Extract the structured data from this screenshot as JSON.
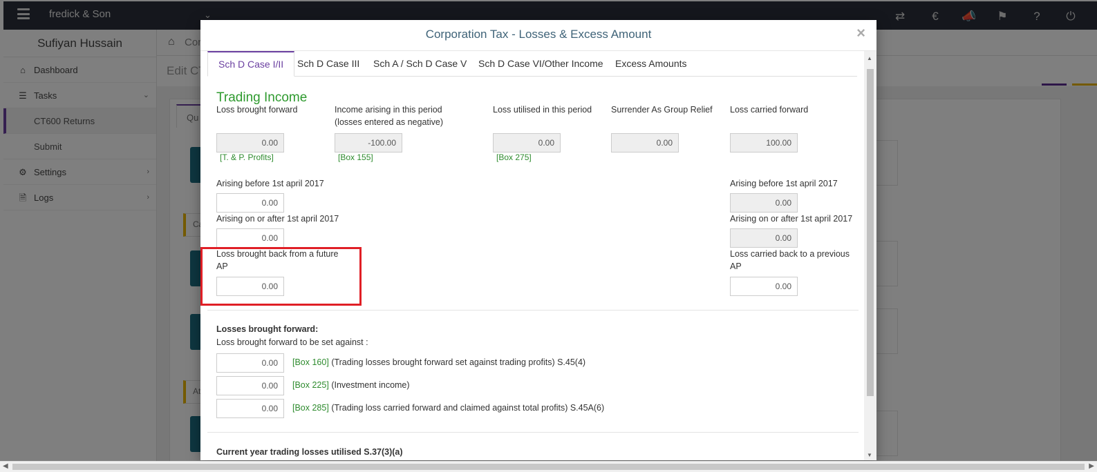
{
  "topbar": {
    "company": "fredick & Son",
    "icons": [
      "menu-icon",
      "chevron-down-icon",
      "transfer-icon",
      "currency-icon",
      "announcement-icon",
      "tag-icon",
      "help-icon",
      "power-icon"
    ]
  },
  "sidebar": {
    "user": "Sufiyan Hussain",
    "items": [
      {
        "label": "Dashboard",
        "icon": "home-icon"
      },
      {
        "label": "Tasks",
        "icon": "list-icon"
      },
      {
        "label": "Settings",
        "icon": "gear-icon"
      },
      {
        "label": "Logs",
        "icon": "file-icon"
      }
    ],
    "subitems": [
      "CT600 Returns",
      "Submit"
    ]
  },
  "background": {
    "breadcrumb": "Cor",
    "edit_title": "Edit CT",
    "tab_fragment": "Qu",
    "card_fragment_1": "Ca",
    "card_fragment_2": "At"
  },
  "modal": {
    "title": "Corporation Tax - Losses & Excess Amount",
    "close": "×",
    "tabs": [
      "Sch D Case I/II",
      "Sch D Case III",
      "Sch A / Sch D Case V",
      "Sch D Case VI/Other Income",
      "Excess Amounts"
    ],
    "active_tab": 0,
    "section_title": "Trading Income",
    "columns": {
      "loss_bf": {
        "label": "Loss brought forward",
        "value": "0.00",
        "box": "[T. & P. Profits]"
      },
      "income": {
        "label": "Income arising in this period (losses entered as negative)",
        "value": "-100.00",
        "box": "[Box 155]"
      },
      "utilised": {
        "label": "Loss utilised in this period",
        "value": "0.00",
        "box": "[Box 275]"
      },
      "surrender": {
        "label": "Surrender As Group Relief",
        "value": "0.00"
      },
      "loss_cf": {
        "label": "Loss carried forward",
        "value": "100.00"
      }
    },
    "left_extra": {
      "before_label": "Arising before 1st april 2017",
      "before_value": "0.00",
      "after_label": "Arising on or after 1st april 2017",
      "after_value": "0.00",
      "future_label": "Loss brought back from a future AP",
      "future_value": "0.00"
    },
    "right_extra": {
      "before_label": "Arising before 1st april 2017",
      "before_value": "0.00",
      "after_label": "Arising on or after 1st april 2017",
      "after_value": "0.00",
      "previous_label": "Loss carried back to a previous AP",
      "previous_value": "0.00"
    },
    "losses_bf": {
      "heading": "Losses brought forward:",
      "subheading": "Loss brought forward to be set against  :",
      "rows": [
        {
          "value": "0.00",
          "box": "[Box 160]",
          "text": "(Trading losses brought forward set against trading profits) S.45(4)"
        },
        {
          "value": "0.00",
          "box": "[Box 225]",
          "text": "(Investment income)"
        },
        {
          "value": "0.00",
          "box": "[Box 285]",
          "text": "(Trading loss carried forward and claimed against total profits) S.45A(6)"
        }
      ]
    },
    "current_year_heading": "Current year trading losses utilised S.37(3)(a)"
  }
}
